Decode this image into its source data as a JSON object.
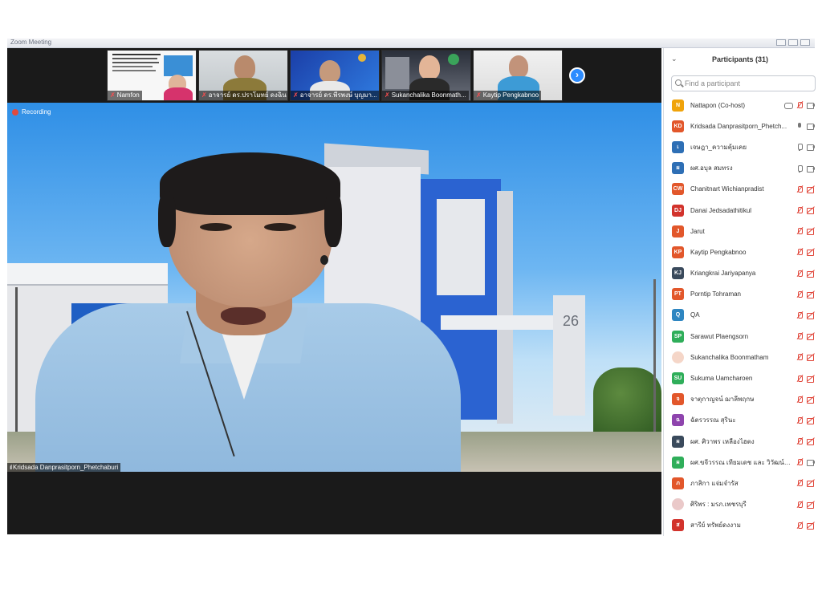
{
  "window": {
    "title": "Zoom Meeting"
  },
  "thumbnails": [
    {
      "name": "Namfon"
    },
    {
      "name": "อาจารย์ ดร.ปราโมทย์ ดงฉิน"
    },
    {
      "name": "อาจารย์ ดร.พีรพงษ์ บุญมา..."
    },
    {
      "name": "Sukanchalika Boonmath..."
    },
    {
      "name": "Kaytip Pengkabnoo"
    }
  ],
  "main_video": {
    "recording_label": "Recording",
    "speaker_name": "Kridsada Danprasitporn_Phetchaburi",
    "building_number": "26"
  },
  "participants_panel": {
    "title": "Participants (31)",
    "search_placeholder": "Find a participant",
    "items": [
      {
        "initials": "N",
        "name": "Nattapon (Co-host)",
        "color": "#f0a30a",
        "mic": "muted",
        "cam": "on",
        "extra": "share"
      },
      {
        "initials": "KD",
        "name": "Kridsada Danprasitporn_Phetch...",
        "color": "#e2572b",
        "mic": "active",
        "cam": "on"
      },
      {
        "initials": "เ",
        "name": "เจษฎา_ความคุ้มเคย",
        "color": "#2e6fb5",
        "mic": "on",
        "cam": "on"
      },
      {
        "initials": "ผ",
        "name": "ผศ.อบุล สมทรง",
        "color": "#2e6fb5",
        "mic": "on",
        "cam": "on"
      },
      {
        "initials": "CW",
        "name": "Chanitnart Wichianpradist",
        "color": "#e2572b",
        "mic": "muted",
        "cam": "off"
      },
      {
        "initials": "DJ",
        "name": "Danai Jedsadathitikul",
        "color": "#d2332c",
        "mic": "muted",
        "cam": "off"
      },
      {
        "initials": "J",
        "name": "Jarut",
        "color": "#e2572b",
        "mic": "muted",
        "cam": "off"
      },
      {
        "initials": "KP",
        "name": "Kaytip Pengkabnoo",
        "color": "#e2572b",
        "mic": "muted",
        "cam": "off"
      },
      {
        "initials": "KJ",
        "name": "Kriangkrai Jariyapanya",
        "color": "#3a4a5c",
        "mic": "muted",
        "cam": "off"
      },
      {
        "initials": "PT",
        "name": "Porntip Tohraman",
        "color": "#e2572b",
        "mic": "muted",
        "cam": "off"
      },
      {
        "initials": "Q",
        "name": "QA",
        "color": "#2e86c1",
        "mic": "muted",
        "cam": "off"
      },
      {
        "initials": "SP",
        "name": "Sarawut Plaengsorn",
        "color": "#2fae5a",
        "mic": "muted",
        "cam": "off"
      },
      {
        "initials": "",
        "name": "Sukanchalika Boonmatham",
        "color": "#f5d6c8",
        "mic": "muted",
        "cam": "off",
        "photo": true
      },
      {
        "initials": "SU",
        "name": "Sukuma Uamcharoen",
        "color": "#2fae5a",
        "mic": "muted",
        "cam": "off"
      },
      {
        "initials": "จ",
        "name": "จาตุกาญจน์ ฌาลีพฤกษ",
        "color": "#e2572b",
        "mic": "muted",
        "cam": "off"
      },
      {
        "initials": "ฉ",
        "name": "ฉัตรวรรณ สุรินะ",
        "color": "#8e44ad",
        "mic": "muted",
        "cam": "off"
      },
      {
        "initials": "ผ",
        "name": "ผศ. ศิวาพร เหลืองไฮตง",
        "color": "#3a4a5c",
        "mic": "muted",
        "cam": "off"
      },
      {
        "initials": "ผ",
        "name": "ผศ.ขจีวรรณ เทียมเดช และ วิวัฒน์ สมแส...",
        "color": "#2fae5a",
        "mic": "muted",
        "cam": "on"
      },
      {
        "initials": "ภ",
        "name": "ภาสิกา แจ่มจำรัส",
        "color": "#e2572b",
        "mic": "muted",
        "cam": "off"
      },
      {
        "initials": "",
        "name": "ศิริพร : มรภ.เพชรบุรี",
        "color": "#eac9c9",
        "mic": "muted",
        "cam": "off",
        "photo": true
      },
      {
        "initials": "ส",
        "name": "สารีย์ ทรัพย์ดงงาม",
        "color": "#d2332c",
        "mic": "muted",
        "cam": "off"
      }
    ]
  }
}
